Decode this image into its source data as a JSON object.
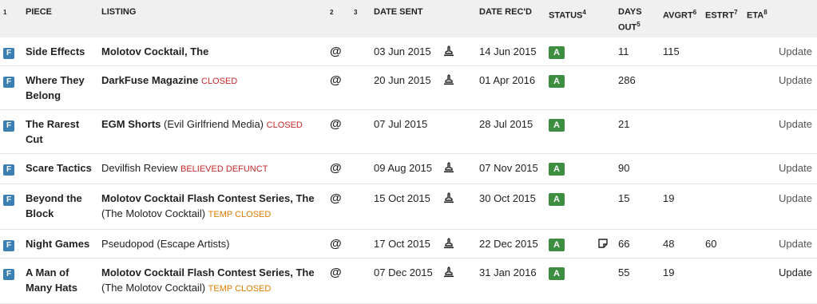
{
  "headers": {
    "c1": "1",
    "piece": "PIECE",
    "listing": "LISTING",
    "c2": "2",
    "c3": "3",
    "date_sent": "DATE SENT",
    "date_recd": "DATE REC'D",
    "status": "STATUS",
    "status_sup": "4",
    "days_out_1": "DAYS",
    "days_out_2": "OUT",
    "days_out_sup": "5",
    "avgrt": "AVGRT",
    "avgrt_sup": "6",
    "estrt": "ESTRT",
    "estrt_sup": "7",
    "eta": "ETA",
    "eta_sup": "8"
  },
  "rows": [
    {
      "type": "F",
      "piece": "Side Effects",
      "market": "Molotov Cocktail, The",
      "market_sub": "",
      "flag": "",
      "method": "@",
      "date_sent": "03 Jun 2015",
      "date_recd": "14 Jun 2015",
      "status": "A",
      "days_out": "11",
      "avgrt": "115",
      "estrt": "",
      "eta": "",
      "action": "Update"
    },
    {
      "type": "F",
      "piece": "Where They Belong",
      "market": "DarkFuse Magazine",
      "market_sub": "",
      "flag": "CLOSED",
      "method": "@",
      "date_sent": "20 Jun 2015",
      "date_recd": "01 Apr 2016",
      "status": "A",
      "days_out": "286",
      "avgrt": "",
      "estrt": "",
      "eta": "",
      "action": "Update"
    },
    {
      "type": "F",
      "piece": "The Rarest Cut",
      "market": "EGM Shorts",
      "market_sub": "(Evil Girlfriend Media)",
      "flag": "CLOSED",
      "method": "@",
      "date_sent": "07 Jul 2015",
      "date_recd": "28 Jul 2015",
      "status": "A",
      "days_out": "21",
      "avgrt": "",
      "estrt": "",
      "eta": "",
      "action": "Update"
    },
    {
      "type": "F",
      "piece": "Scare Tactics",
      "market": "Devilfish Review",
      "market_sub": "",
      "flag": "BELIEVED DEFUNCT",
      "method": "@",
      "date_sent": "09 Aug 2015",
      "date_recd": "07 Nov 2015",
      "status": "A",
      "days_out": "90",
      "avgrt": "",
      "estrt": "",
      "eta": "",
      "action": "Update"
    },
    {
      "type": "F",
      "piece": "Beyond the Block",
      "market": "Molotov Cocktail Flash Contest Series, The",
      "market_sub": "(The Molotov Cocktail)",
      "flag": "TEMP CLOSED",
      "method": "@",
      "date_sent": "15 Oct 2015",
      "date_recd": "30 Oct 2015",
      "status": "A",
      "days_out": "15",
      "avgrt": "19",
      "estrt": "",
      "eta": "",
      "action": "Update"
    },
    {
      "type": "F",
      "piece": "Night Games",
      "market": "Pseudopod",
      "market_sub": "(Escape Artists)",
      "flag": "",
      "method": "@",
      "date_sent": "17 Oct 2015",
      "date_recd": "22 Dec 2015",
      "status": "A",
      "days_out": "66",
      "avgrt": "48",
      "estrt": "60",
      "eta": "",
      "action": "Update"
    },
    {
      "type": "F",
      "piece": "A Man of Many Hats",
      "market": "Molotov Cocktail Flash Contest Series, The",
      "market_sub": "(The Molotov Cocktail)",
      "flag": "TEMP CLOSED",
      "method": "@",
      "date_sent": "07 Dec 2015",
      "date_recd": "31 Jan 2016",
      "status": "A",
      "days_out": "55",
      "avgrt": "19",
      "estrt": "",
      "eta": "",
      "action": "Update"
    }
  ]
}
